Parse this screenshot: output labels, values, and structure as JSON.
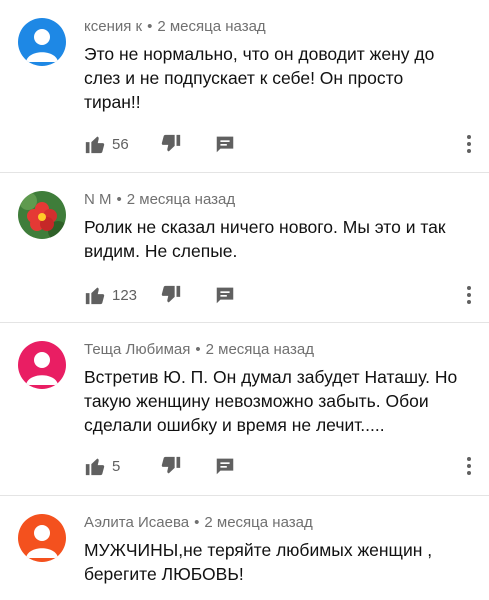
{
  "comments": [
    {
      "author": "ксения к",
      "separator": "•",
      "time": "2 месяца назад",
      "text": "Это не нормально, что он доводит жену до слез и не подпускает к себе! Он просто тиран!!",
      "likes": "56",
      "avatar": {
        "type": "default-person",
        "color": "#1e88e5"
      }
    },
    {
      "author": "N M",
      "separator": "•",
      "time": "2 месяца назад",
      "text": "Ролик не сказал ничего нового. Мы это и так видим. Не слепые.",
      "likes": "123",
      "avatar": {
        "type": "flower-photo",
        "color": "#3f7d3a"
      }
    },
    {
      "author": "Теща Любимая",
      "separator": "•",
      "time": "2 месяца назад",
      "text": "Встретив Ю. П. Он думал  забудет Наташу. Но такую женщину невозможно забыть. Обои сделали ошибку и время не лечит.....",
      "likes": "5",
      "avatar": {
        "type": "default-person",
        "color": "#e91e63"
      }
    },
    {
      "author": "Аэлита Исаева",
      "separator": "•",
      "time": "2 месяца назад",
      "text": "МУЖЧИНЫ,не теряйте любимых  женщин , берегите ЛЮБОВЬ!",
      "likes": "",
      "avatar": {
        "type": "default-person",
        "color": "#f4511e"
      }
    }
  ]
}
